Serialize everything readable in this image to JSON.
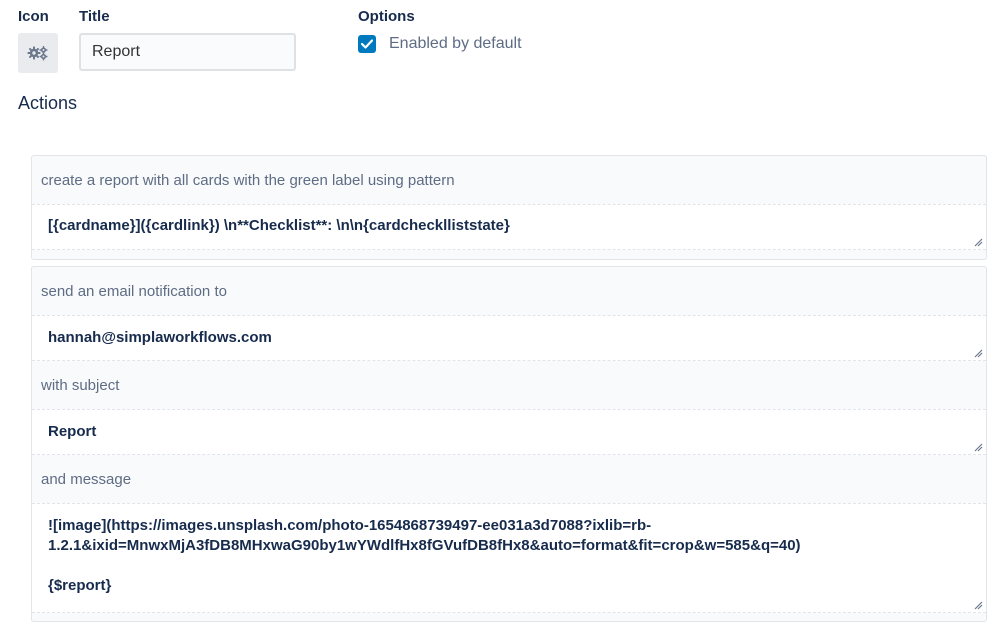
{
  "header": {
    "icon_label": "Icon",
    "title_label": "Title",
    "title_value": "Report",
    "options_label": "Options",
    "enabled_label": "Enabled by default",
    "enabled_checked": true,
    "gear_icon": "gears-icon"
  },
  "actions": {
    "heading": "Actions",
    "card1": {
      "description": "create a report with all cards with the green label using pattern",
      "pattern": "[{cardname}]({cardlink}) \\n**Checklist**: \\n\\n{cardchecklliststate}"
    },
    "card2": {
      "description": "send an email notification to",
      "to": "hannah@simplaworkflows.com",
      "subject_label": "with subject",
      "subject": "Report",
      "message_label": "and message",
      "message": "![image](https://images.unsplash.com/photo-1654868739497-ee031a3d7088?ixlib=rb-\n1.2.1&ixid=MnwxMjA3fDB8MHxwaG90by1wYWdlfHx8fGVufDB8fHx8&auto=format&fit=crop&w=585&q=40)\n\n{$report}"
    }
  },
  "colors": {
    "accent": "#0079bf",
    "text": "#172b4d",
    "muted": "#5e6c84"
  }
}
